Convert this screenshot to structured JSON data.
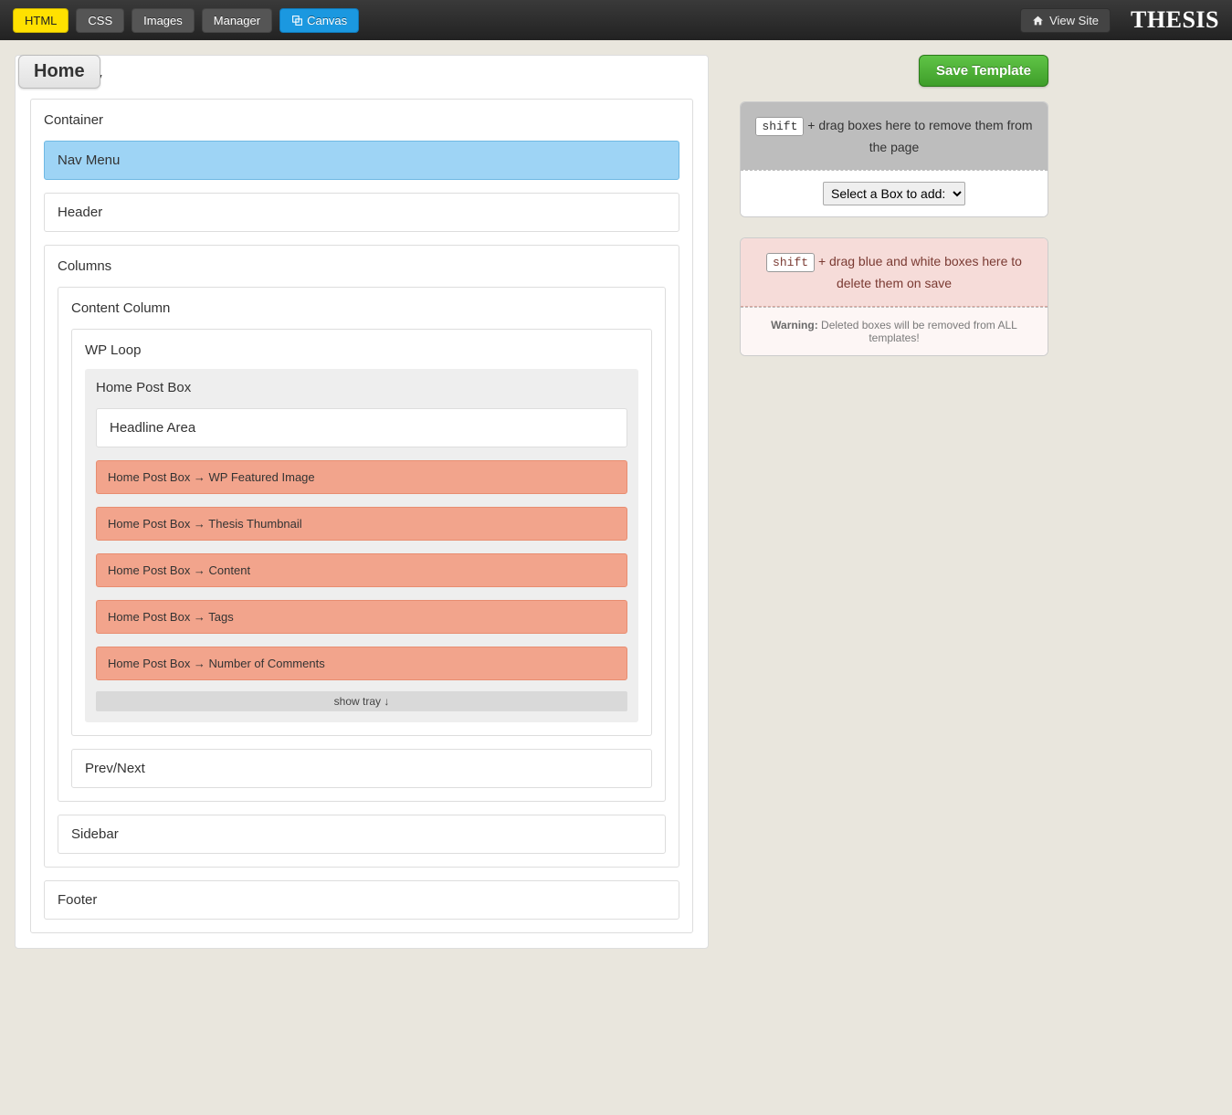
{
  "topbar": {
    "tabs": {
      "html": "HTML",
      "css": "CSS",
      "images": "Images",
      "manager": "Manager",
      "canvas": "Canvas"
    },
    "view_site": "View Site",
    "logo": "THESIS"
  },
  "header": {
    "page_title": "Home",
    "save_button": "Save Template"
  },
  "canvas": {
    "html_body": "HTML Body",
    "container": "Container",
    "nav_menu": "Nav Menu",
    "header_box": "Header",
    "columns": "Columns",
    "content_column": "Content Column",
    "wp_loop": "WP Loop",
    "home_post_box": "Home Post Box",
    "headline_area": "Headline Area",
    "hooks": [
      "Home Post Box → WP Featured Image",
      "Home Post Box → Thesis Thumbnail",
      "Home Post Box → Content",
      "Home Post Box → Tags",
      "Home Post Box → Number of Comments"
    ],
    "show_tray": "show tray ↓",
    "prev_next": "Prev/Next",
    "sidebar": "Sidebar",
    "footer": "Footer"
  },
  "side": {
    "remove": {
      "shift": "shift",
      "text": " + drag boxes here to remove them from the page",
      "select_label": "Select a Box to add:"
    },
    "delete": {
      "shift": "shift",
      "text": " + drag blue and white boxes here to delete them on save",
      "warning_label": "Warning:",
      "warning_text": " Deleted boxes will be removed from ALL templates!"
    }
  }
}
